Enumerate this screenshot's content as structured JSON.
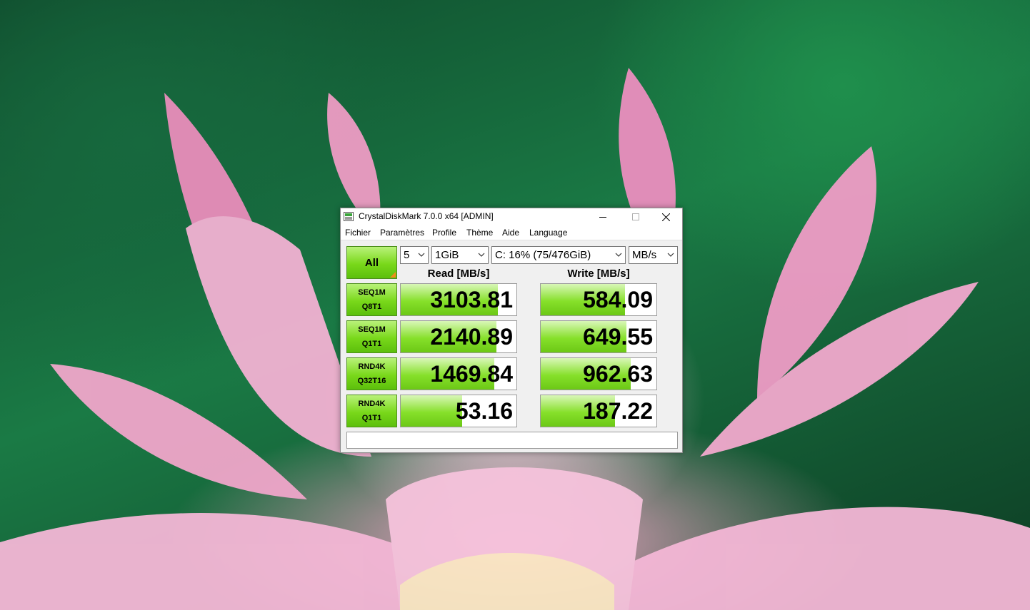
{
  "window": {
    "title": "CrystalDiskMark 7.0.0 x64 [ADMIN]"
  },
  "menu": [
    "Fichier",
    "Paramètres",
    "Profile",
    "Thème",
    "Aide",
    "Language"
  ],
  "controls": {
    "all_label": "All",
    "count": "5",
    "size": "1GiB",
    "drive": "C: 16% (75/476GiB)",
    "unit": "MB/s"
  },
  "headers": {
    "read": "Read [MB/s]",
    "write": "Write [MB/s]"
  },
  "tests": [
    {
      "line1": "SEQ1M",
      "line2": "Q8T1",
      "read": "3103.81",
      "write": "584.09",
      "read_level": 0.84,
      "write_level": 0.73
    },
    {
      "line1": "SEQ1M",
      "line2": "Q1T1",
      "read": "2140.89",
      "write": "649.55",
      "read_level": 0.83,
      "write_level": 0.74
    },
    {
      "line1": "RND4K",
      "line2": "Q32T16",
      "read": "1469.84",
      "write": "962.63",
      "read_level": 0.81,
      "write_level": 0.78
    },
    {
      "line1": "RND4K",
      "line2": "Q1T1",
      "read": "53.16",
      "write": "187.22",
      "read_level": 0.53,
      "write_level": 0.64
    }
  ],
  "status": "",
  "colors": {
    "bar_green": "#86e02a",
    "button_green": "#79d81a",
    "accent_orange": "#f08c1a"
  }
}
